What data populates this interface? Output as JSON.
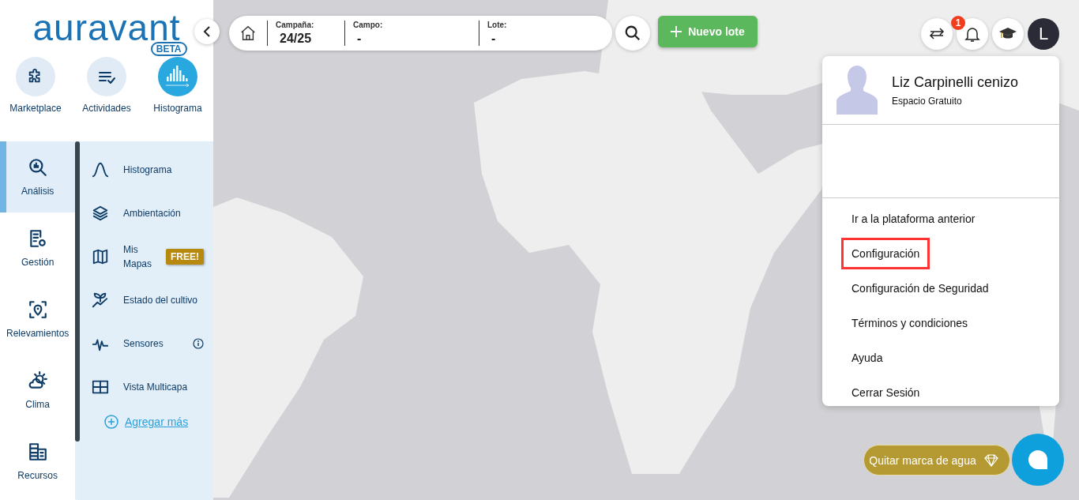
{
  "logo": {
    "text": "auravant",
    "badge": "BETA"
  },
  "shortcuts": [
    {
      "label": "Marketplace",
      "selected": false
    },
    {
      "label": "Actividades",
      "selected": false
    },
    {
      "label": "Histograma",
      "selected": true
    }
  ],
  "nav": [
    {
      "label": "Análisis",
      "selected": true
    },
    {
      "label": "Gestión",
      "selected": false
    },
    {
      "label": "Relevamientos",
      "selected": false
    },
    {
      "label": "Clima",
      "selected": false
    },
    {
      "label": "Recursos",
      "selected": false
    }
  ],
  "submenu": {
    "items": [
      {
        "label": "Histograma"
      },
      {
        "label": "Ambientación"
      },
      {
        "label": "Mis Mapas",
        "badge": "FREE!"
      },
      {
        "label": "Estado del cultivo"
      },
      {
        "label": "Sensores",
        "info": true
      },
      {
        "label": "Vista Multicapa"
      }
    ],
    "add_link": "Agregar más"
  },
  "filter_bar": {
    "fields": [
      {
        "label": "Campaña:",
        "value": "24/25"
      },
      {
        "label": "Campo:",
        "value": "-"
      },
      {
        "label": "Lote:",
        "value": "-"
      }
    ]
  },
  "new_button": "Nuevo lote",
  "notification_count": "1",
  "avatar_letter": "L",
  "user_menu": {
    "name": "Liz Carpinelli cenizo",
    "plan": "Espacio Gratuito",
    "items": [
      {
        "label": "Ir a la plataforma anterior",
        "highlighted": false
      },
      {
        "label": "Configuración",
        "highlighted": true
      },
      {
        "label": "Configuración de Seguridad",
        "highlighted": false
      },
      {
        "label": "Términos y condiciones",
        "highlighted": false
      },
      {
        "label": "Ayuda",
        "highlighted": false
      },
      {
        "label": "Cerrar Sesión",
        "highlighted": false
      }
    ]
  },
  "watermark_button": "Quitar marca de agua"
}
